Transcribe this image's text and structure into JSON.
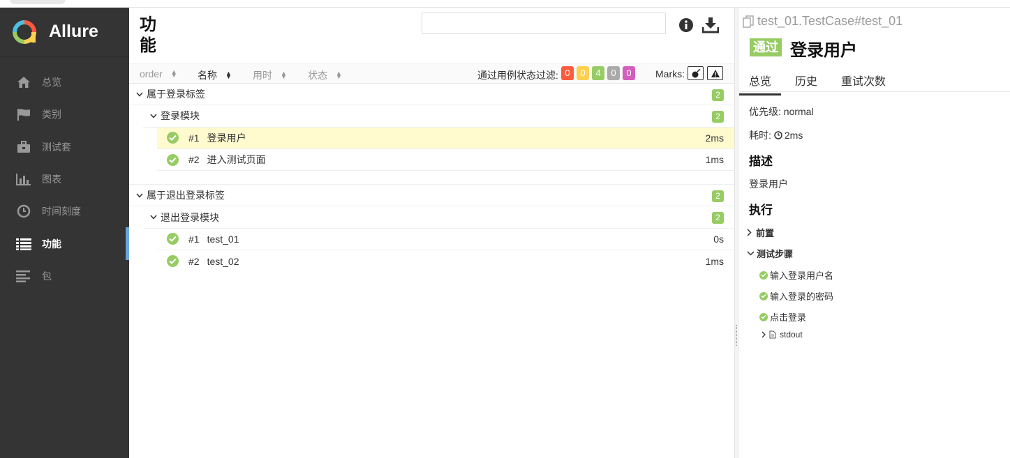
{
  "app": {
    "name": "Allure"
  },
  "sidebar": {
    "items": [
      {
        "label": "总览",
        "icon": "home-icon"
      },
      {
        "label": "类别",
        "icon": "flag-icon"
      },
      {
        "label": "测试套",
        "icon": "briefcase-icon"
      },
      {
        "label": "图表",
        "icon": "bar-chart-icon"
      },
      {
        "label": "时间刻度",
        "icon": "clock-icon"
      },
      {
        "label": "功能",
        "icon": "list-icon",
        "active": true
      },
      {
        "label": "包",
        "icon": "align-left-icon"
      }
    ]
  },
  "main": {
    "title": "功能",
    "search": {
      "value": "",
      "placeholder": ""
    },
    "sort": {
      "order": "order",
      "name": "名称",
      "duration": "用时",
      "status": "状态"
    },
    "filter": {
      "label": "通过用例状态过滤:",
      "counts": [
        {
          "value": "0",
          "color": "#fd5a3e"
        },
        {
          "value": "0",
          "color": "#ffd050"
        },
        {
          "value": "4",
          "color": "#97cc64"
        },
        {
          "value": "0",
          "color": "#aaaaaa"
        },
        {
          "value": "0",
          "color": "#d35ebe"
        }
      ]
    },
    "marks_label": "Marks:",
    "groups": [
      {
        "name": "属于登录标签",
        "count": "2",
        "sub": {
          "name": "登录模块",
          "count": "2",
          "cases": [
            {
              "num": "#1",
              "name": "登录用户",
              "duration": "2ms"
            },
            {
              "num": "#2",
              "name": "进入测试页面",
              "duration": "1ms"
            }
          ]
        }
      },
      {
        "name": "属于退出登录标签",
        "count": "2",
        "sub": {
          "name": "退出登录模块",
          "count": "2",
          "cases": [
            {
              "num": "#1",
              "name": "test_01",
              "duration": "0s"
            },
            {
              "num": "#2",
              "name": "test_02",
              "duration": "1ms"
            }
          ]
        }
      }
    ]
  },
  "detail": {
    "path": "test_01.TestCase#test_01",
    "status": "通过",
    "title": "登录用户",
    "tabs": [
      "总览",
      "历史",
      "重试次数"
    ],
    "severity": "优先级: normal",
    "duration_label": "耗时:",
    "duration": "2ms",
    "description_heading": "描述",
    "description": "登录用户",
    "execution_heading": "执行",
    "setup_label": "前置",
    "steps_label": "测试步骤",
    "steps": [
      "输入登录用户名",
      "输入登录的密码",
      "点击登录"
    ],
    "attachment": "stdout"
  }
}
